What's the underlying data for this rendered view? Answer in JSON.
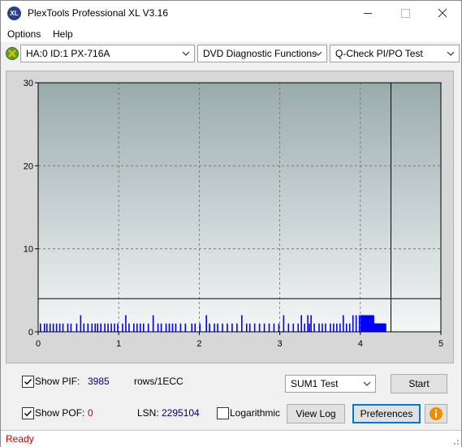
{
  "window": {
    "title": "PlexTools Professional XL V3.16",
    "logo_text": "XL"
  },
  "menu": {
    "options": "Options",
    "help": "Help"
  },
  "toolbar": {
    "drive": "HA:0 ID:1  PX-716A",
    "function": "DVD Diagnostic Functions",
    "test": "Q-Check PI/PO Test"
  },
  "chart_data": {
    "type": "bar",
    "x_ticks": [
      "0",
      "1",
      "2",
      "3",
      "4",
      "5"
    ],
    "y_ticks": [
      "0",
      "10",
      "20",
      "30"
    ],
    "xlim": [
      0,
      5
    ],
    "ylim": [
      0,
      30
    ],
    "threshold": 4,
    "end_marker_x": 4.38,
    "grid": true,
    "colors": {
      "plot_top": "#9aabab",
      "plot_bottom": "#f4f7f7",
      "bars": "#0000ff",
      "grid": "#6e6e6e"
    },
    "series": [
      {
        "values": [
          [
            0.02,
            1
          ],
          [
            0.07,
            1
          ],
          [
            0.1,
            1
          ],
          [
            0.14,
            1
          ],
          [
            0.18,
            1
          ],
          [
            0.22,
            1
          ],
          [
            0.26,
            1
          ],
          [
            0.3,
            1
          ],
          [
            0.36,
            1
          ],
          [
            0.4,
            1
          ],
          [
            0.47,
            1
          ],
          [
            0.52,
            2
          ],
          [
            0.56,
            1
          ],
          [
            0.61,
            1
          ],
          [
            0.66,
            1
          ],
          [
            0.7,
            1
          ],
          [
            0.73,
            1
          ],
          [
            0.77,
            1
          ],
          [
            0.82,
            1
          ],
          [
            0.86,
            1
          ],
          [
            0.9,
            1
          ],
          [
            0.94,
            1
          ],
          [
            0.98,
            1
          ],
          [
            1.04,
            1
          ],
          [
            1.08,
            2
          ],
          [
            1.12,
            1
          ],
          [
            1.18,
            1
          ],
          [
            1.22,
            1
          ],
          [
            1.26,
            1
          ],
          [
            1.3,
            1
          ],
          [
            1.36,
            1
          ],
          [
            1.42,
            2
          ],
          [
            1.48,
            1
          ],
          [
            1.52,
            1
          ],
          [
            1.58,
            1
          ],
          [
            1.62,
            1
          ],
          [
            1.66,
            1
          ],
          [
            1.7,
            1
          ],
          [
            1.76,
            1
          ],
          [
            1.82,
            1
          ],
          [
            1.9,
            1
          ],
          [
            1.94,
            1
          ],
          [
            2.0,
            1
          ],
          [
            2.08,
            2
          ],
          [
            2.12,
            1
          ],
          [
            2.18,
            1
          ],
          [
            2.22,
            1
          ],
          [
            2.28,
            1
          ],
          [
            2.34,
            1
          ],
          [
            2.4,
            1
          ],
          [
            2.46,
            1
          ],
          [
            2.52,
            2
          ],
          [
            2.58,
            1
          ],
          [
            2.62,
            1
          ],
          [
            2.68,
            1
          ],
          [
            2.74,
            1
          ],
          [
            2.8,
            1
          ],
          [
            2.86,
            1
          ],
          [
            2.92,
            1
          ],
          [
            2.98,
            1
          ],
          [
            3.04,
            2
          ],
          [
            3.1,
            1
          ],
          [
            3.16,
            1
          ],
          [
            3.22,
            1
          ],
          [
            3.26,
            2
          ],
          [
            3.3,
            1
          ],
          [
            3.34,
            2
          ],
          [
            3.36,
            1
          ],
          [
            3.38,
            2
          ],
          [
            3.42,
            1
          ],
          [
            3.48,
            1
          ],
          [
            3.52,
            1
          ],
          [
            3.56,
            1
          ],
          [
            3.62,
            1
          ],
          [
            3.66,
            1
          ],
          [
            3.7,
            1
          ],
          [
            3.74,
            1
          ],
          [
            3.78,
            2
          ],
          [
            3.82,
            1
          ],
          [
            3.86,
            1
          ],
          [
            3.9,
            2
          ],
          [
            3.94,
            2
          ],
          [
            3.98,
            2
          ],
          [
            4.02,
            1
          ],
          [
            4.06,
            1
          ],
          [
            4.1,
            1
          ],
          [
            4.14,
            1
          ],
          [
            4.18,
            1
          ],
          [
            4.22,
            1
          ],
          [
            4.26,
            1
          ]
        ]
      }
    ]
  },
  "controls": {
    "show_pif_label": "Show PIF:",
    "pif_value": "3985",
    "pif_unit": "rows/1ECC",
    "show_pof_label": "Show POF:",
    "pof_value": "0",
    "lsn_label": "LSN:",
    "lsn_value": "2295104",
    "logarithmic_label": "Logarithmic",
    "sum_select": "SUM1 Test",
    "start_button": "Start",
    "view_log_button": "View Log",
    "preferences_button": "Preferences"
  },
  "status": {
    "text": "Ready"
  }
}
